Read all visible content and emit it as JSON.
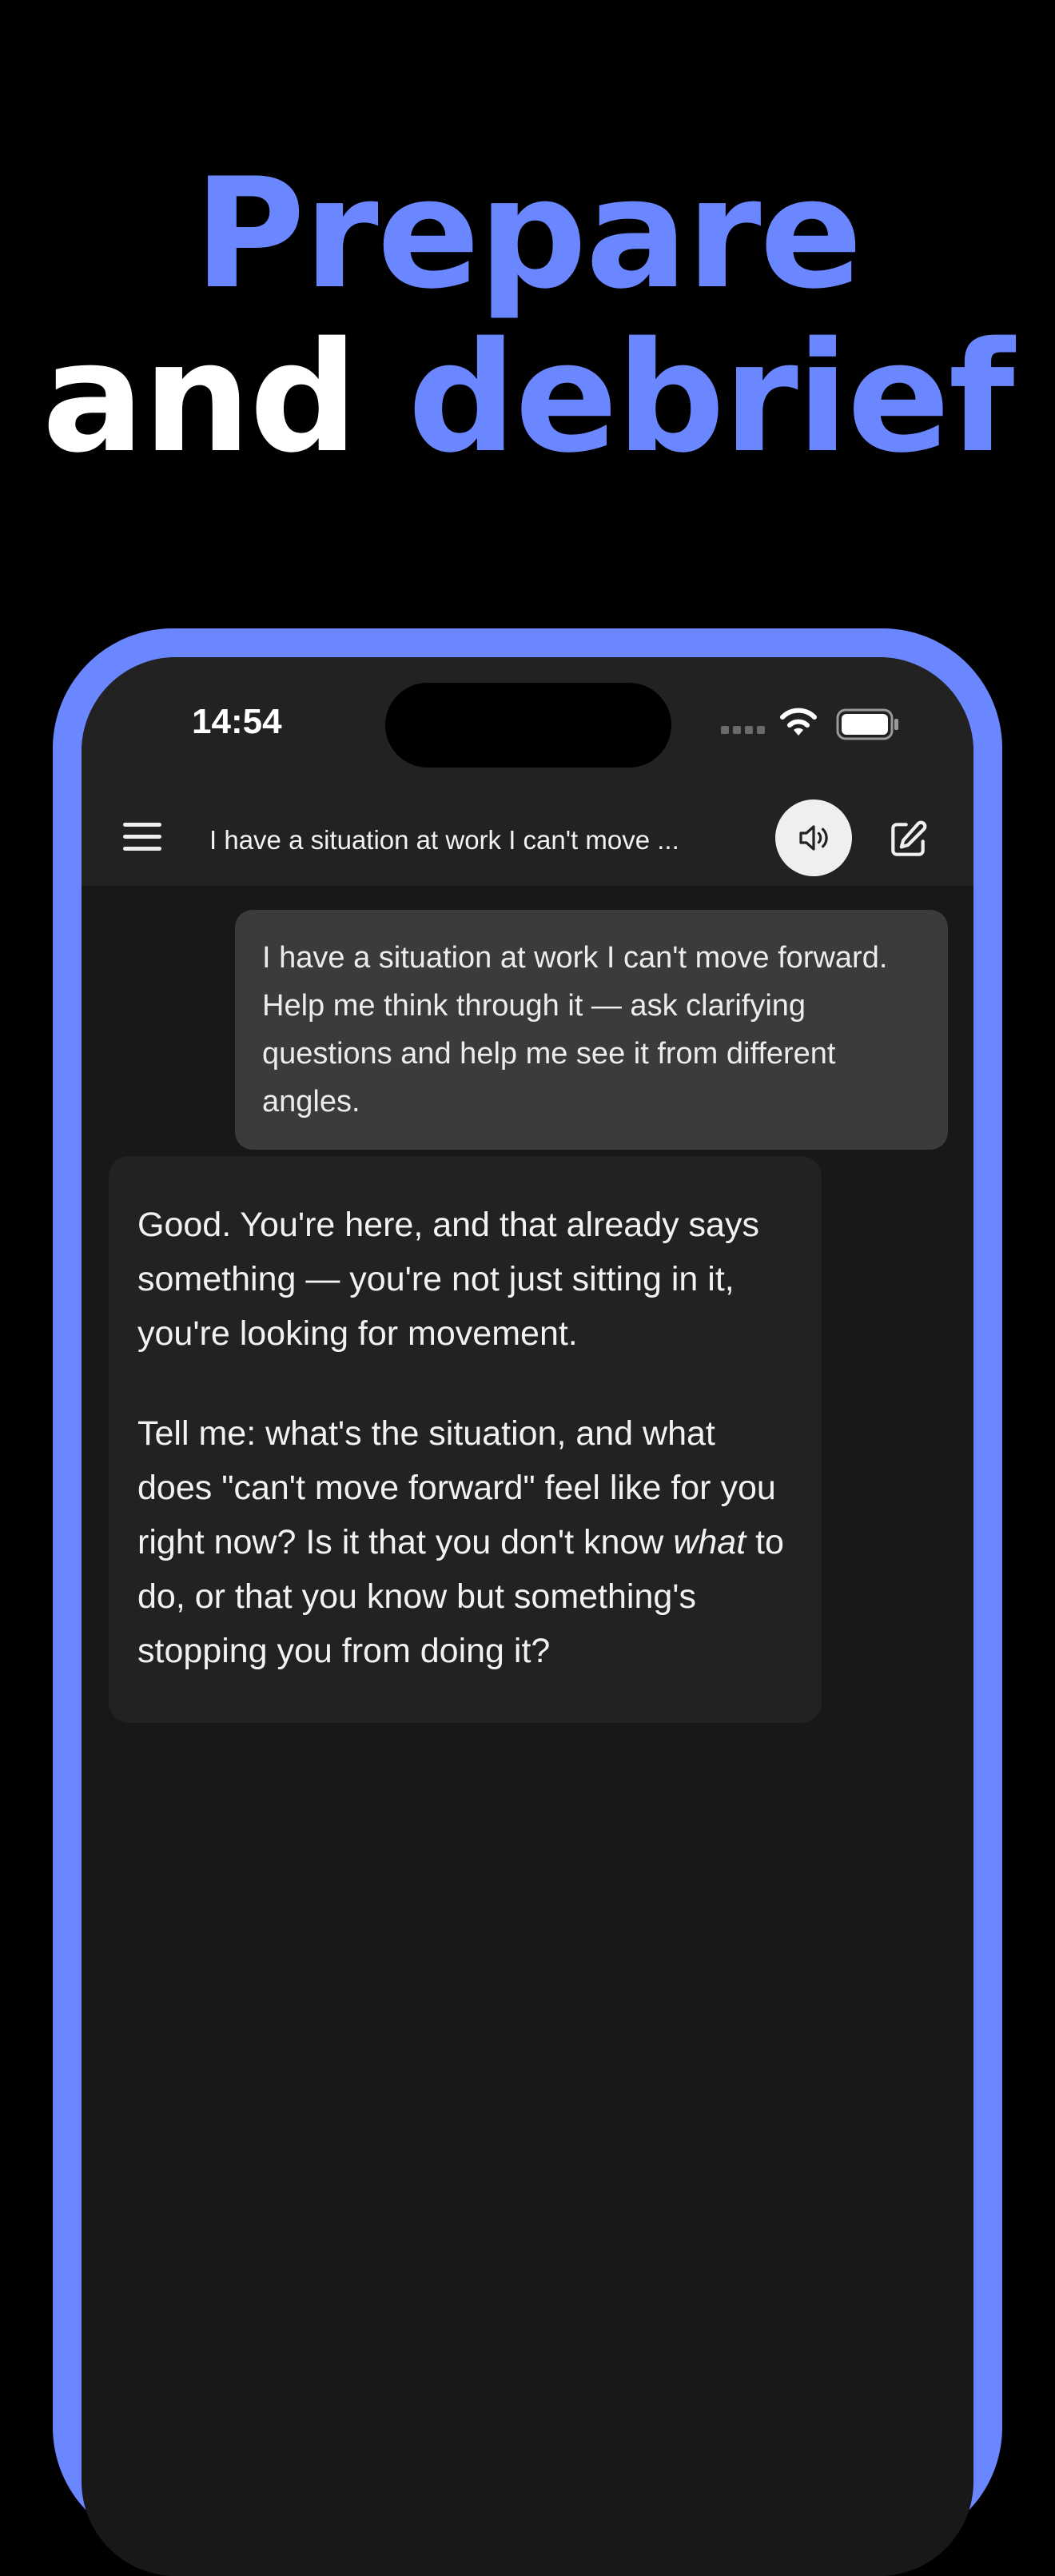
{
  "headline": {
    "line1": "Prepare",
    "line2_white": "and",
    "line2_accent": "debrief"
  },
  "colors": {
    "accent": "#6b87ff",
    "background": "#000000",
    "screen": "#181818",
    "user_bubble": "#3b3b3b",
    "assistant_bubble": "#222222"
  },
  "status_bar": {
    "time": "14:54",
    "icons": [
      "signal-icon",
      "wifi-icon",
      "battery-icon"
    ]
  },
  "nav": {
    "title": "I have a situation at work I can't move ...",
    "icons": [
      "menu-icon",
      "speaker-icon",
      "new-chat-icon"
    ]
  },
  "messages": {
    "user": "I have a situation at work I can't move forward. Help me think through it — ask clarifying questions and help me see it from different angles.",
    "assistant_p1": "Good. You're here, and that already says something — you're not just sitting in it, you're looking for movement.",
    "assistant_p2_before": "Tell me: what's the situation, and what does \"can't move forward\" feel like for you right now? Is it that you don't know ",
    "assistant_p2_em": "what",
    "assistant_p2_after": " to do, or that you know but something's stopping you from doing it?"
  }
}
